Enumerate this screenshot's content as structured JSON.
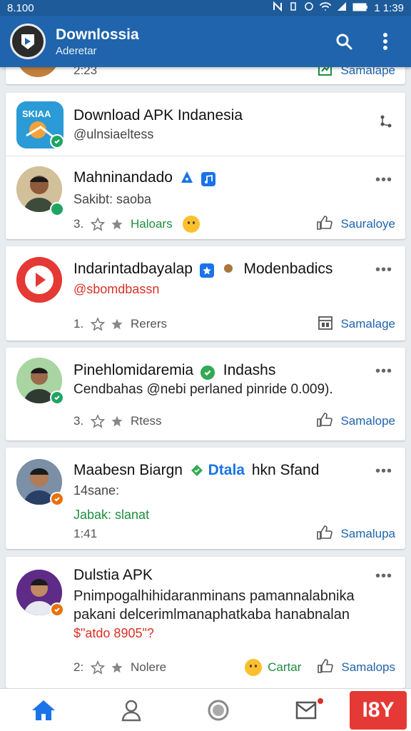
{
  "status_bar": {
    "time_left": "8.100",
    "time_right": "1 1:39",
    "battery": "2"
  },
  "app_bar": {
    "title": "Downlossia",
    "subtitle": "Aderetar"
  },
  "cards": [
    {
      "top_row": {
        "count": "2:23",
        "share_label": "Samalape"
      }
    },
    {
      "header": {
        "name": "Download APK Indanesia",
        "handle": "@ulnsiaeltess",
        "logo_text": "SKIAA"
      },
      "post": {
        "name": "Mahninandado",
        "sub": "Sakibt: saoba",
        "count": "3.",
        "tag": "Haloars",
        "share_label": "Sauraloye"
      }
    },
    {
      "name": "Indarintadbayalap",
      "extra": "Modenbadics",
      "sub": "@sbomdbassn",
      "count": "1.",
      "tag": "Rerers",
      "share_label": "Samalage"
    },
    {
      "name": "Pinehlomidaremia",
      "extra": "Indashs",
      "body": "Cendbahas @nebi perlaned pinride 0.009).",
      "count": "3.",
      "tag": "Rtess",
      "share_label": "Samalope"
    },
    {
      "name": "Maabesn Biargn",
      "brand": "Dtala",
      "extra": "hkn Sfand",
      "sub": "14sane:",
      "link": "Jabak: slanat",
      "count": "1:41",
      "share_label": "Samalupa"
    },
    {
      "name": "Dulstia APK",
      "body_line1": "Pnimpogalhihidaranminans pamannalabnika",
      "body_line2": "pakani delcerimlmanaphatkaba hanabnalan",
      "body_line3": "$\"atdo 8905\"?",
      "count": "2:",
      "tag": "Nolere",
      "reaction": "Cartar",
      "share_label": "Samalops"
    }
  ],
  "bottom_nav": {
    "last_label": "I8Y"
  },
  "colors": {
    "primary": "#1f64ad",
    "status_bar": "#1e5b9a",
    "accent_red": "#e53935",
    "green": "#1e8e3e"
  }
}
